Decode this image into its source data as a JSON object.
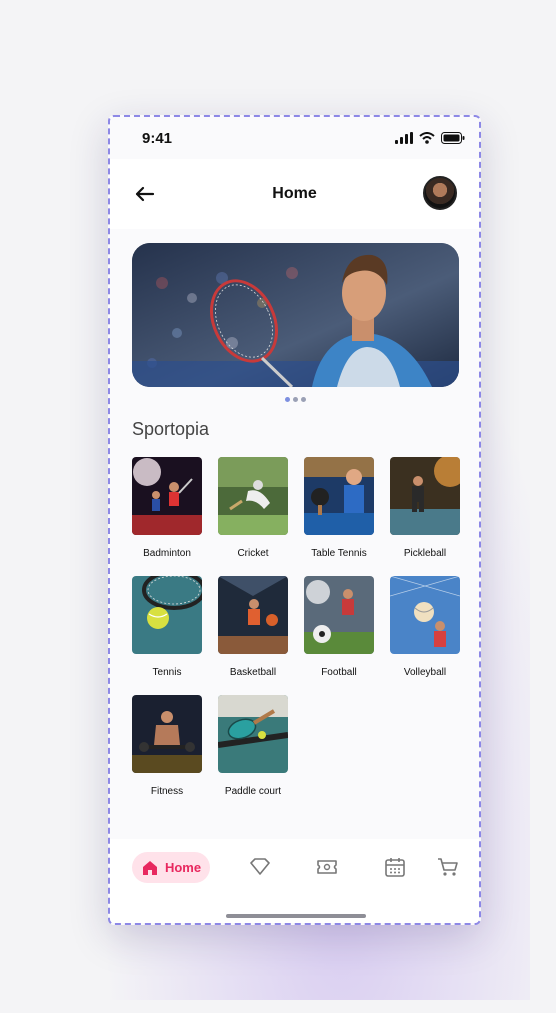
{
  "status_bar": {
    "time": "9:41",
    "icons": [
      "cellular-icon",
      "wifi-icon",
      "battery-icon"
    ]
  },
  "header": {
    "title": "Home",
    "back_icon": "arrow-left-icon",
    "avatar": "user-avatar"
  },
  "banner": {
    "image": "badminton-player-hero",
    "slides": 3,
    "active_slide": 1
  },
  "section": {
    "title": "Sportopia"
  },
  "sports": [
    {
      "label": "Badminton",
      "icon": "badminton-photo"
    },
    {
      "label": "Cricket",
      "icon": "cricket-photo"
    },
    {
      "label": "Table Tennis",
      "icon": "table-tennis-photo"
    },
    {
      "label": "Pickleball",
      "icon": "pickleball-photo"
    },
    {
      "label": "Tennis",
      "icon": "tennis-photo"
    },
    {
      "label": "Basketball",
      "icon": "basketball-photo"
    },
    {
      "label": "Football",
      "icon": "football-photo"
    },
    {
      "label": "Volleyball",
      "icon": "volleyball-photo"
    },
    {
      "label": "Fitness",
      "icon": "fitness-photo"
    },
    {
      "label": "Paddle court",
      "icon": "paddle-court-photo"
    }
  ],
  "bottom_nav": {
    "home_label": "Home",
    "items": [
      "home-icon",
      "diamond-icon",
      "ticket-icon",
      "calendar-icon",
      "cart-icon"
    ]
  },
  "colors": {
    "accent": "#e8285f",
    "accent_bg": "#ffe2ea",
    "frame": "#8d88e6"
  }
}
